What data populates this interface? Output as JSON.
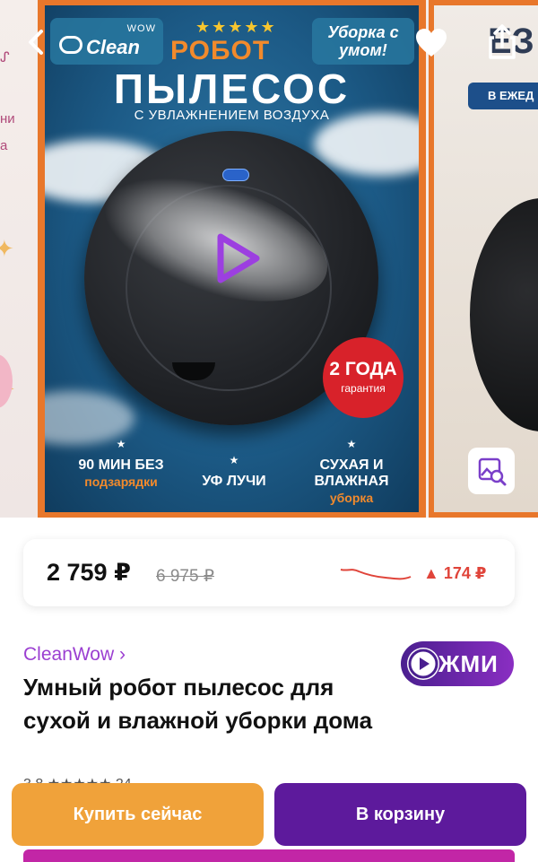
{
  "gallery": {
    "main_slide": {
      "brand_wow": "WOW",
      "brand_name": "Clean",
      "stars": "★★★★★",
      "title_line1": "РОБОТ",
      "badge_text": "Уборка с умом!",
      "title_line2": "ПЫЛЕСОС",
      "subtitle": "С УВЛАЖНЕНИЕМ ВОЗДУХА",
      "warranty_big": "2 ГОДА",
      "warranty_small": "гарантия",
      "features": [
        {
          "star": "★",
          "text": "90 МИН БЕЗ",
          "accent": "подзарядки"
        },
        {
          "star": "★",
          "text": "УФ ЛУЧИ",
          "accent": ""
        },
        {
          "star": "★",
          "text": "СУХАЯ И ВЛАЖНАЯ",
          "accent": "уборка"
        }
      ]
    },
    "next_slide": {
      "title_fragment": "ЕЗ",
      "pill_fragment": "В ЕЖЕД"
    },
    "prev_slide": {
      "fragments": [
        "ни",
        "а"
      ]
    }
  },
  "price": {
    "current": "2 759 ₽",
    "old": "6 975 ₽",
    "diff": "▲ 174 ₽"
  },
  "product": {
    "brand": "CleanWow ›",
    "title": "Умный робот пылесос для сухой и влажной уборки дома",
    "rating_partial": "3.8 ★★★★★ 24"
  },
  "promo": {
    "label": "ЖМИ"
  },
  "actions": {
    "buy_now": "Купить сейчас",
    "add_to_cart": "В корзину"
  },
  "colors": {
    "accent_purple": "#5d1a9c",
    "accent_orange": "#f0a23a",
    "price_up_red": "#e0443a",
    "brand_link": "#9b3fd1"
  },
  "icons": [
    "back-icon",
    "heart-icon",
    "share-icon",
    "image-search-icon",
    "play-icon"
  ]
}
